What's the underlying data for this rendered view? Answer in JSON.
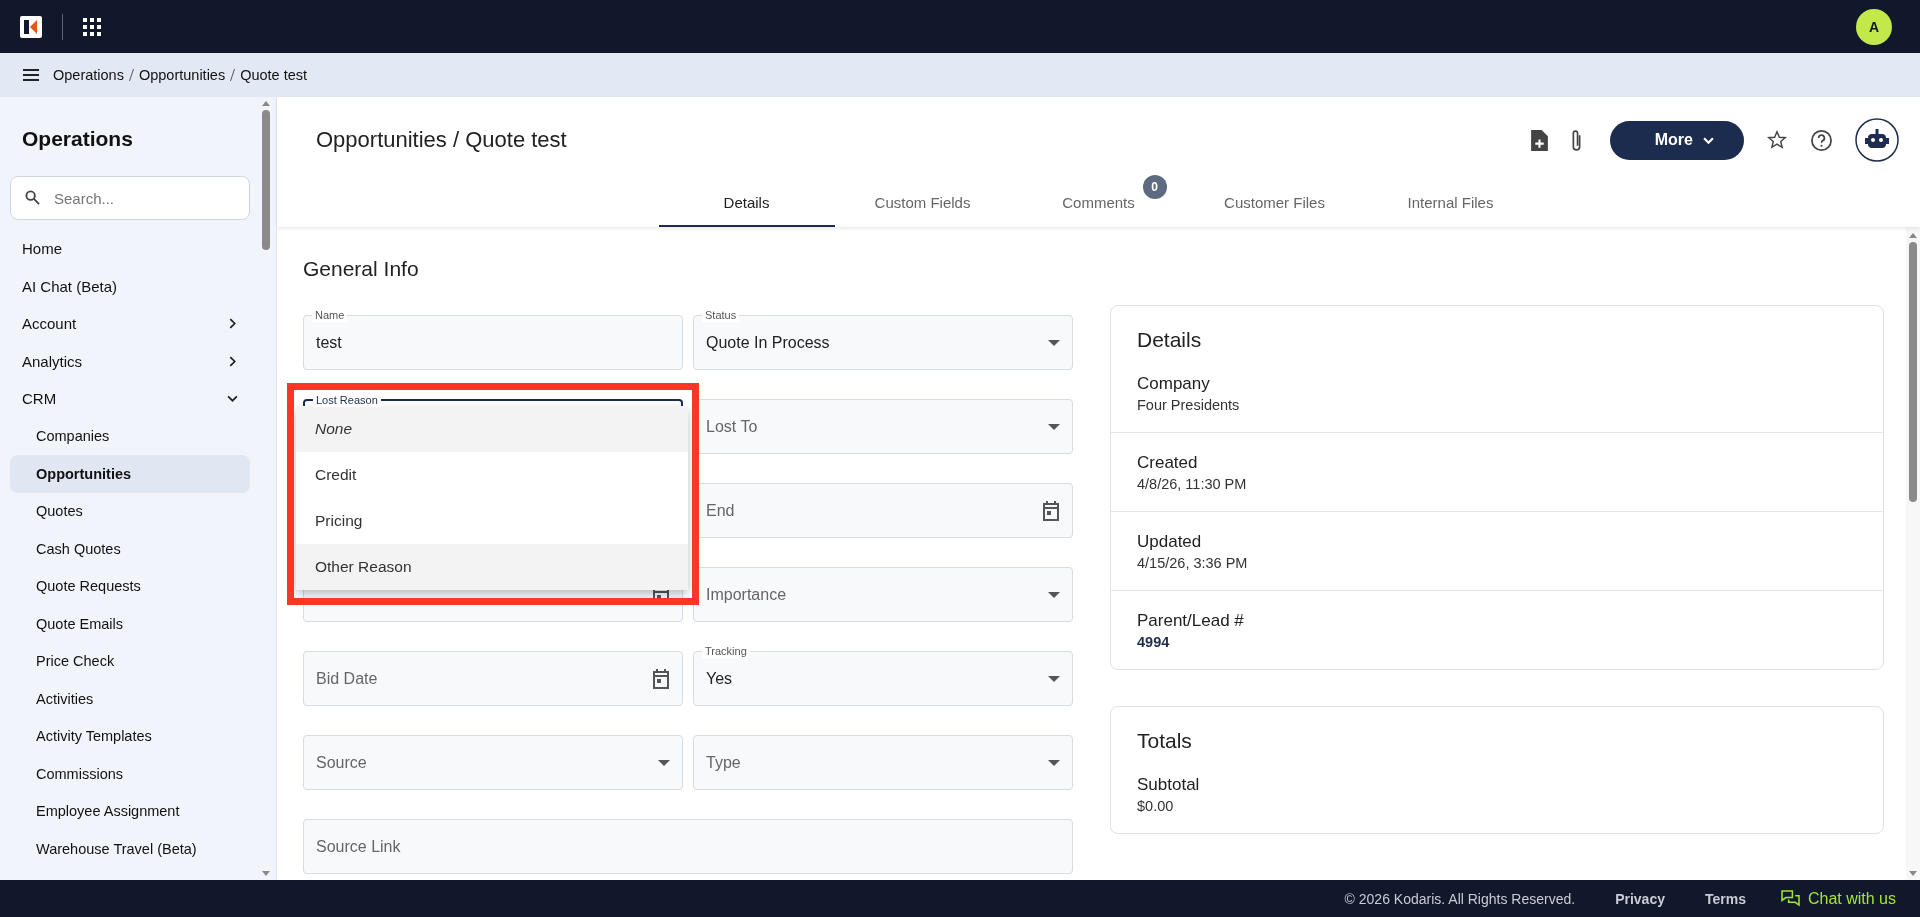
{
  "topbar": {
    "avatar": "A"
  },
  "breadcrumb": [
    "Operations",
    "Opportunities",
    "Quote test"
  ],
  "sidebar": {
    "title": "Operations",
    "search": {
      "placeholder": "Search..."
    },
    "items": [
      {
        "label": "Home",
        "selected": false
      },
      {
        "label": "AI Chat (Beta)",
        "selected": false
      },
      {
        "label": "Account",
        "selected": false,
        "expanded": false
      },
      {
        "label": "Analytics",
        "selected": false,
        "expanded": false
      },
      {
        "label": "CRM",
        "selected": false,
        "expanded": true,
        "children": [
          {
            "label": "Companies",
            "selected": false
          },
          {
            "label": "Opportunities",
            "selected": true
          },
          {
            "label": "Quotes",
            "selected": false
          },
          {
            "label": "Cash Quotes",
            "selected": false
          },
          {
            "label": "Quote Requests",
            "selected": false
          },
          {
            "label": "Quote Emails",
            "selected": false
          },
          {
            "label": "Price Check",
            "selected": false
          },
          {
            "label": "Activities",
            "selected": false
          },
          {
            "label": "Activity Templates",
            "selected": false
          },
          {
            "label": "Commissions",
            "selected": false
          },
          {
            "label": "Employee Assignment",
            "selected": false
          },
          {
            "label": "Warehouse Travel (Beta)",
            "selected": false
          }
        ]
      }
    ]
  },
  "page": {
    "title": "Opportunities / Quote test",
    "more_button": "More"
  },
  "tabs": [
    {
      "label": "Details",
      "selected": true
    },
    {
      "label": "Custom Fields",
      "selected": false
    },
    {
      "label": "Comments",
      "selected": false,
      "badge": "0"
    },
    {
      "label": "Customer Files",
      "selected": false
    },
    {
      "label": "Internal Files",
      "selected": false
    }
  ],
  "general_info": {
    "title": "General Info",
    "rows": [
      {
        "left": {
          "kind": "text",
          "label": "Name",
          "value": "test"
        },
        "right": {
          "kind": "select",
          "label": "Status",
          "value": "Quote In Process"
        }
      },
      {
        "left": {
          "kind": "select",
          "label": "Lost Reason",
          "focused": true
        },
        "right": {
          "kind": "select",
          "placeholder": "Lost To"
        }
      },
      {
        "right": {
          "kind": "date",
          "placeholder": "End"
        }
      },
      {
        "left": {
          "kind": "date"
        },
        "right": {
          "kind": "select",
          "placeholder": "Importance"
        }
      },
      {
        "left": {
          "kind": "date",
          "placeholder": "Bid Date"
        },
        "right": {
          "kind": "select",
          "label": "Tracking",
          "value": "Yes"
        }
      },
      {
        "left": {
          "kind": "select",
          "placeholder": "Source"
        },
        "right": {
          "kind": "select",
          "placeholder": "Type"
        }
      },
      {
        "full": {
          "kind": "text",
          "placeholder": "Source Link"
        }
      }
    ]
  },
  "dropdown": {
    "options": [
      {
        "kind": "empty",
        "label": "None",
        "highlighted": true
      },
      {
        "kind": "reason",
        "label": "Credit",
        "highlighted": false
      },
      {
        "kind": "reason",
        "label": "Pricing",
        "highlighted": false
      },
      {
        "kind": "reason",
        "label": "Other Reason",
        "highlighted": true
      }
    ]
  },
  "highlight": {
    "color": "#fb3529"
  },
  "cards": [
    {
      "title": "Details",
      "items": [
        {
          "label": "Company",
          "value": "Four Presidents",
          "link": false
        },
        {
          "label": "Created",
          "value": "4/8/26, 11:30 PM",
          "link": false
        },
        {
          "label": "Updated",
          "value": "4/15/26, 3:36 PM",
          "link": false
        },
        {
          "label": "Parent/Lead #",
          "value": "4994",
          "link": true
        }
      ]
    },
    {
      "title": "Totals",
      "items": [
        {
          "label": "Subtotal",
          "value": "$0.00",
          "link": false
        }
      ]
    }
  ],
  "footer": {
    "copyright": "© 2026 Kodaris. All Rights Reserved.",
    "links": [
      "Privacy",
      "Terms"
    ],
    "chat": "Chat with us"
  }
}
